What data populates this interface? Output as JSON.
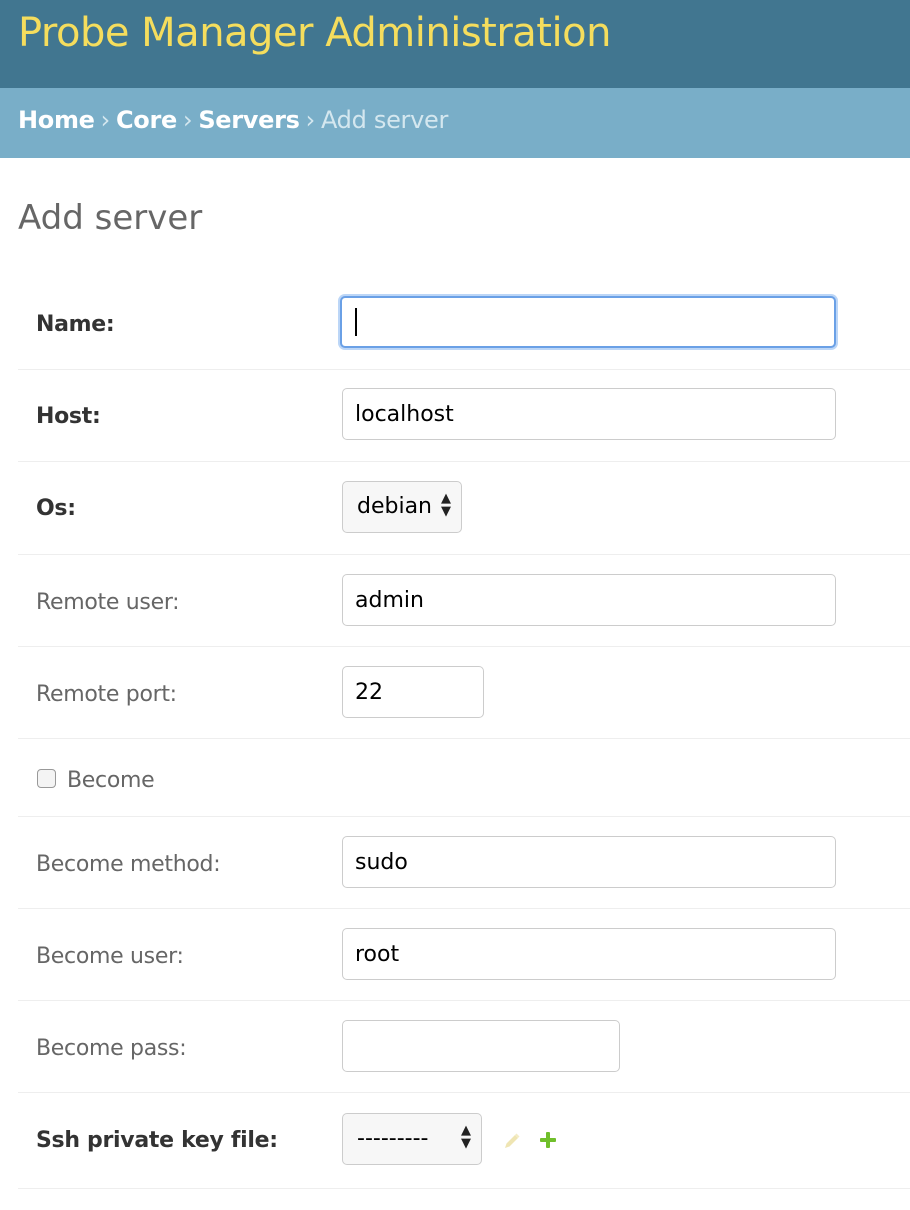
{
  "header": {
    "site_title": "Probe Manager Administration"
  },
  "breadcrumbs": {
    "items": [
      "Home",
      "Core",
      "Servers"
    ],
    "separator": "›",
    "current": "Add server"
  },
  "page": {
    "title": "Add server"
  },
  "form": {
    "name": {
      "label": "Name:",
      "value": ""
    },
    "host": {
      "label": "Host:",
      "value": "localhost"
    },
    "os": {
      "label": "Os:",
      "selected": "debian"
    },
    "remote_user": {
      "label": "Remote user:",
      "value": "admin"
    },
    "remote_port": {
      "label": "Remote port:",
      "value": "22"
    },
    "become": {
      "label": "Become",
      "checked": false
    },
    "become_method": {
      "label": "Become method:",
      "value": "sudo"
    },
    "become_user": {
      "label": "Become user:",
      "value": "root"
    },
    "become_pass": {
      "label": "Become pass:",
      "value": ""
    },
    "ssh_private_key_file": {
      "label": "Ssh private key file:",
      "selected": "---------",
      "edit_icon": "pencil-icon",
      "add_icon": "plus-icon"
    }
  },
  "colors": {
    "header_bg": "#417690",
    "title": "#f5dd5d",
    "breadcrumb_bg": "#79aec8",
    "add_icon": "#70bf2b",
    "edit_icon": "#efe5b3"
  }
}
